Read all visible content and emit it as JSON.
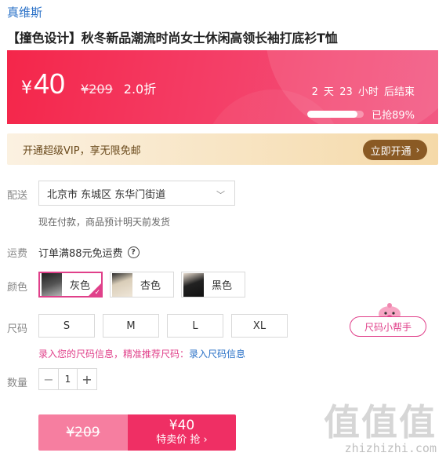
{
  "store": {
    "name": "真维斯"
  },
  "product": {
    "title": "【撞色设计】秋冬新品潮流时尚女士休闲高领长袖打底衫T恤"
  },
  "price": {
    "symbol": "¥",
    "value": "40",
    "original": "¥209",
    "discount": "2.0折",
    "countdown": "2 天 23 小时 后结束",
    "sold_percent": 89,
    "sold_text": "已抢89%"
  },
  "vip": {
    "text": "开通超级VIP，享无限免邮",
    "button_label": "立即开通",
    "button_icon": "chevron-right-icon"
  },
  "shipping": {
    "label": "配送",
    "address": "北京市 东城区 东华门街道",
    "note": "现在付款，商品预计明天前发货"
  },
  "freight": {
    "label": "运费",
    "text": "订单满88元免运费",
    "help_icon": "question-circle-icon"
  },
  "color": {
    "label": "颜色",
    "options": [
      {
        "name": "灰色",
        "selected": true
      },
      {
        "name": "杏色",
        "selected": false
      },
      {
        "name": "黑色",
        "selected": false
      }
    ]
  },
  "size": {
    "label": "尺码",
    "options": [
      "S",
      "M",
      "L",
      "XL"
    ],
    "helper_label": "尺码小帮手",
    "hint": "录入您的尺码信息，精准推荐尺码：",
    "hint_link": "录入尺码信息"
  },
  "quantity": {
    "label": "数量",
    "value": "1",
    "minus": "−",
    "plus": "+"
  },
  "buy": {
    "original_price": "¥209",
    "price": "¥40",
    "label": "特卖价 抢 ›"
  },
  "watermark": {
    "logo": "值值值",
    "url": "zhizhizhi.com"
  },
  "colors": {
    "accent": "#ef2f64",
    "pink": "#e0408a",
    "link": "#2a71c7",
    "vip_brown": "#8a5a24"
  }
}
